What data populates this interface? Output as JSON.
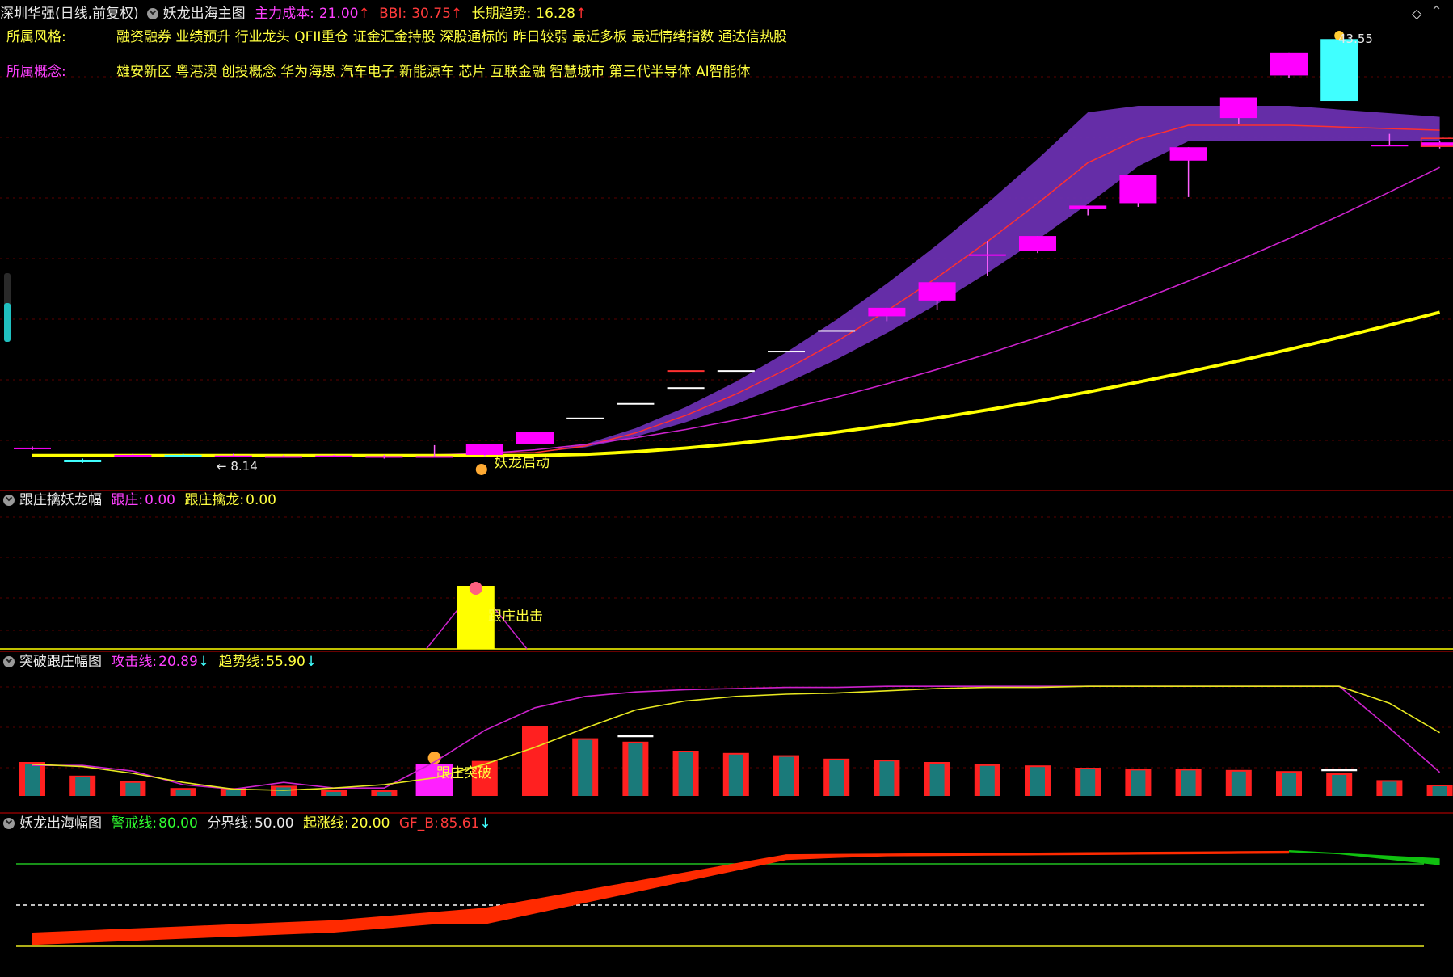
{
  "main_panel": {
    "stock": "深圳华强(日线,前复权)",
    "indicator_name": "妖龙出海主图",
    "main_cost_label": "主力成本:",
    "main_cost_value": "21.00",
    "bbi_label": "BBI:",
    "bbi_value": "30.75",
    "long_trend_label": "长期趋势:",
    "long_trend_value": "16.28",
    "style_label": "所属风格:",
    "style_value": "融资融券 业绩预升 行业龙头 QFII重仓 证金汇金持股 深股通标的 昨日较弱 最近多板 最近情绪指数 通达信热股",
    "concept_label": "所属概念:",
    "concept_value": "雄安新区 粤港澳 创投概念 华为海思 汽车电子 新能源车 芯片 互联金融 智慧城市 第三代半导体 AI智能体",
    "high_label": "43.55",
    "low_label": "← 8.14",
    "signal_label": "妖龙启动"
  },
  "panel2": {
    "name": "跟庄擒妖龙幅",
    "gz_label": "跟庄:",
    "gz_value": "0.00",
    "gzql_label": "跟庄擒龙:",
    "gzql_value": "0.00",
    "signal_label": "跟庄出击"
  },
  "panel3": {
    "name": "突破跟庄幅图",
    "attack_label": "攻击线:",
    "attack_value": "20.89",
    "trend_label": "趋势线:",
    "trend_value": "55.90",
    "signal_label": "跟庄突破"
  },
  "panel4": {
    "name": "妖龙出海幅图",
    "warn_label": "警戒线:",
    "warn_value": "80.00",
    "div_label": "分界线:",
    "div_value": "50.00",
    "rise_label": "起涨线:",
    "rise_value": "20.00",
    "gfb_label": "GF_B:",
    "gfb_value": "85.61"
  },
  "arrows": {
    "up": "↑",
    "down": "↓"
  },
  "chart_data": {
    "type": "candlestick",
    "price_candles": [
      {
        "o": 9.3,
        "c": 9.4,
        "h": 9.5,
        "l": 9.2
      },
      {
        "o": 8.4,
        "c": 8.2,
        "h": 8.5,
        "l": 8.14
      },
      {
        "o": 8.7,
        "c": 8.8,
        "h": 8.9,
        "l": 8.6
      },
      {
        "o": 8.8,
        "c": 8.7,
        "h": 8.9,
        "l": 8.6
      },
      {
        "o": 8.7,
        "c": 8.75,
        "h": 8.9,
        "l": 8.6
      },
      {
        "o": 8.7,
        "c": 8.7,
        "h": 8.8,
        "l": 8.6
      },
      {
        "o": 8.7,
        "c": 8.75,
        "h": 8.8,
        "l": 8.6
      },
      {
        "o": 8.6,
        "c": 8.7,
        "h": 8.8,
        "l": 8.5
      },
      {
        "o": 8.7,
        "c": 8.7,
        "h": 9.6,
        "l": 8.6
      },
      {
        "o": 8.8,
        "c": 9.7,
        "h": 9.7,
        "l": 8.7
      },
      {
        "o": 9.7,
        "c": 10.7,
        "h": 10.7,
        "l": 9.7
      },
      {
        "o": 11.8,
        "c": 11.8,
        "h": 11.8,
        "l": 11.8
      },
      {
        "o": 13.0,
        "c": 13.0,
        "h": 13.0,
        "l": 13.0
      },
      {
        "o": 14.3,
        "c": 14.3,
        "h": 14.3,
        "l": 14.3
      },
      {
        "o": 15.7,
        "c": 15.7,
        "h": 15.7,
        "l": 15.7
      },
      {
        "o": 17.3,
        "c": 17.3,
        "h": 17.3,
        "l": 17.3
      },
      {
        "o": 19.0,
        "c": 19.0,
        "h": 19.0,
        "l": 19.0
      },
      {
        "o": 20.2,
        "c": 20.9,
        "h": 20.9,
        "l": 19.8
      },
      {
        "o": 21.5,
        "c": 23.0,
        "h": 23.0,
        "l": 20.7
      },
      {
        "o": 25.3,
        "c": 25.3,
        "h": 26.4,
        "l": 23.5
      },
      {
        "o": 25.6,
        "c": 26.8,
        "h": 26.8,
        "l": 25.4
      },
      {
        "o": 29.0,
        "c": 29.3,
        "h": 29.3,
        "l": 28.5
      },
      {
        "o": 29.5,
        "c": 31.8,
        "h": 31.8,
        "l": 29.2
      },
      {
        "o": 33.0,
        "c": 34.1,
        "h": 34.1,
        "l": 30.0
      },
      {
        "o": 36.5,
        "c": 38.2,
        "h": 38.2,
        "l": 36.0
      },
      {
        "o": 40.0,
        "c": 41.9,
        "h": 41.9,
        "l": 39.8
      },
      {
        "o": 43.0,
        "c": 37.9,
        "h": 43.55,
        "l": 37.9
      },
      {
        "o": 34.3,
        "c": 34.3,
        "h": 35.2,
        "l": 34.2
      },
      {
        "o": 34.2,
        "c": 34.5,
        "h": 34.6,
        "l": 34.0
      }
    ],
    "bars_panel3": [
      30,
      18,
      13,
      7,
      7,
      9,
      5,
      5,
      28,
      31,
      62,
      51,
      48,
      40,
      38,
      36,
      33,
      32,
      30,
      28,
      27,
      25,
      24,
      24,
      23,
      22,
      20,
      14,
      10
    ],
    "attack_line": [
      27,
      27,
      22,
      10,
      6,
      12,
      7,
      7,
      30,
      58,
      78,
      88,
      92,
      94,
      95,
      96,
      96,
      97,
      97,
      97,
      97,
      97,
      97,
      97,
      97,
      97,
      97,
      60,
      20.89
    ],
    "trend_line": [
      28,
      26,
      20,
      12,
      6,
      5,
      7,
      10,
      16,
      28,
      43,
      60,
      76,
      84,
      88,
      90,
      91,
      93,
      95,
      96,
      96,
      97,
      97,
      97,
      97,
      97,
      97,
      82,
      55.9
    ]
  },
  "colors": {
    "bg": "#000000",
    "up": "#ff00ff",
    "down": "#40ffff",
    "band": "#6a2fb0",
    "yellow": "#ffff00",
    "magenta_line": "#cc22cc",
    "red_line": "#ff3030",
    "grid": "#5a0000"
  }
}
